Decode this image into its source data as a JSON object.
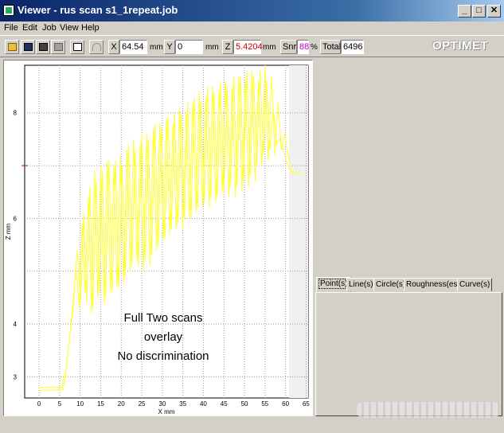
{
  "window": {
    "title": "Viewer - rus scan s1_1repeat.job",
    "minimize_icon": "minimize-icon",
    "maximize_icon": "maximize-icon",
    "close_icon": "close-icon"
  },
  "menu": {
    "items": [
      "File",
      "Edit",
      "Job",
      "View",
      "Help"
    ]
  },
  "toolbar": {
    "icons": [
      "open-folder-icon",
      "save-icon",
      "save-as-icon",
      "print-icon",
      "properties-icon",
      "undo-icon"
    ],
    "x_label": "X",
    "x_value": "64.54",
    "x_unit": "mm",
    "y_label": "Y",
    "y_value": "0",
    "y_unit": "mm",
    "z_label": "Z",
    "z_value": "5.4204",
    "z_unit": "mm",
    "snr_label": "Snr",
    "snr_value": "88",
    "snr_unit": "%",
    "total_label": "Total",
    "total_value": "6496",
    "logo_text": "OPTIMET",
    "z_value_color": "#cc0000",
    "snr_value_color": "#cc00cc"
  },
  "chart_data": {
    "type": "line",
    "xlabel": "X mm",
    "ylabel": "Z mm",
    "xlim": [
      -3.5,
      65.5
    ],
    "ylim": [
      2.6,
      8.9
    ],
    "x_ticks": [
      0,
      5,
      10,
      15,
      20,
      25,
      30,
      35,
      40,
      45,
      50,
      55,
      60,
      65
    ],
    "y_ticks": [
      3,
      4,
      5,
      6,
      7,
      8
    ],
    "y_tick_labels": [
      "3",
      "4",
      "",
      "6",
      "",
      "8"
    ],
    "grid": true,
    "line_color": "#ffff33",
    "marker_color": "#cc0000",
    "marker_z": 7.0,
    "annotation": [
      "Full Two scans",
      "overlay",
      "No discrimination"
    ],
    "series": [
      {
        "x": [
          0,
          5.8,
          6.3,
          7.2,
          8.3,
          9.0,
          9.8,
          10.5,
          11.2,
          12.0,
          12.8,
          13.5,
          14.3,
          15.0,
          15.8,
          16.6,
          17.4,
          18.2,
          19.0,
          19.8,
          20.6,
          21.4,
          22.2,
          23.0,
          23.8,
          24.6,
          25.4,
          26.2,
          27.0,
          27.8,
          28.6,
          29.4,
          30.2,
          31.0,
          31.8,
          32.6,
          33.4,
          34.2,
          35.0,
          35.8,
          36.6,
          37.4,
          38.2,
          39.0,
          39.8,
          40.6,
          41.4,
          42.2,
          43.0,
          43.8,
          44.6,
          45.4,
          46.2,
          47.0,
          47.8,
          48.6,
          49.4,
          50.2,
          51.0,
          51.8,
          52.6,
          53.4,
          54.2,
          55.0,
          55.8,
          56.6,
          57.4,
          58.2,
          59.0,
          59.8,
          60.6,
          61.5,
          62.5,
          63.5,
          64.5
        ],
        "y": [
          2.75,
          2.75,
          2.95,
          3.6,
          4.3,
          5.1,
          4.3,
          5.9,
          4.6,
          6.4,
          4.2,
          6.9,
          4.5,
          7.0,
          4.4,
          7.1,
          4.6,
          7.0,
          4.7,
          7.2,
          4.8,
          7.3,
          5.0,
          7.5,
          5.2,
          7.4,
          5.0,
          7.6,
          5.1,
          7.7,
          5.4,
          7.8,
          5.6,
          7.9,
          5.7,
          7.8,
          5.8,
          8.1,
          5.8,
          8.0,
          6.0,
          8.2,
          6.1,
          8.4,
          6.2,
          8.3,
          6.2,
          8.5,
          6.3,
          8.4,
          6.5,
          8.6,
          6.4,
          8.5,
          6.4,
          8.7,
          6.5,
          8.6,
          6.6,
          8.8,
          6.7,
          8.6,
          7.0,
          8.9,
          7.1,
          8.7,
          7.2,
          8.2,
          7.3,
          7.6,
          7.2,
          6.9,
          6.85,
          6.85,
          6.85
        ]
      },
      {
        "x": [
          0,
          5.5,
          6.5,
          7.5,
          8.5,
          9.3,
          10.1,
          10.9,
          11.6,
          12.4,
          13.1,
          13.9,
          14.7,
          15.4,
          16.2,
          17.0,
          17.8,
          18.6,
          19.4,
          20.2,
          21.0,
          21.8,
          22.6,
          23.4,
          24.2,
          25.0,
          25.8,
          26.6,
          27.4,
          28.2,
          29.0,
          29.8,
          30.6,
          31.4,
          32.2,
          33.0,
          33.8,
          34.6,
          35.4,
          36.2,
          37.0,
          37.8,
          38.6,
          39.4,
          40.2,
          41.0,
          41.8,
          42.6,
          43.4,
          44.2,
          45.0,
          45.8,
          46.6,
          47.4,
          48.2,
          49.0,
          49.8,
          50.6,
          51.4,
          52.2,
          53.0,
          53.8,
          54.6,
          55.4,
          56.2,
          57.0,
          57.8,
          58.6,
          59.4,
          60.2,
          61.0,
          62.0,
          63.0,
          64.5
        ],
        "y": [
          2.8,
          2.8,
          3.1,
          3.8,
          4.6,
          5.4,
          4.4,
          6.1,
          4.4,
          6.6,
          4.3,
          6.7,
          4.6,
          6.9,
          4.5,
          7.1,
          4.6,
          7.1,
          4.7,
          7.0,
          4.9,
          7.4,
          5.1,
          7.3,
          5.1,
          7.6,
          5.2,
          7.5,
          5.3,
          7.8,
          5.5,
          7.7,
          5.6,
          7.9,
          5.8,
          8.0,
          5.9,
          8.0,
          6.0,
          8.2,
          6.0,
          8.3,
          6.2,
          8.2,
          6.3,
          8.5,
          6.4,
          8.4,
          6.4,
          8.6,
          6.5,
          8.5,
          6.6,
          8.7,
          6.6,
          8.7,
          6.7,
          8.8,
          6.8,
          8.7,
          7.0,
          8.8,
          7.2,
          8.6,
          7.3,
          8.1,
          7.4,
          7.5,
          7.3,
          7.1,
          6.9,
          6.85,
          6.85,
          6.85
        ]
      }
    ]
  },
  "tabs": [
    "Point(s)",
    "Line(s)",
    "Circle(s)",
    "Roughness(es)",
    "Curve(s)"
  ]
}
